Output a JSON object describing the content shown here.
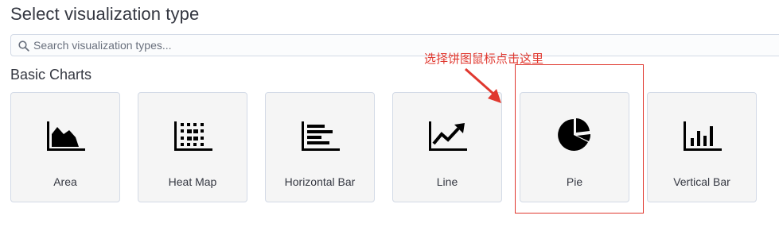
{
  "header": {
    "title": "Select visualization type"
  },
  "search": {
    "placeholder": "Search visualization types..."
  },
  "section": {
    "title": "Basic Charts"
  },
  "cards": [
    {
      "label": "Area",
      "icon": "area-chart-icon"
    },
    {
      "label": "Heat Map",
      "icon": "heat-map-icon"
    },
    {
      "label": "Horizontal Bar",
      "icon": "horizontal-bar-icon"
    },
    {
      "label": "Line",
      "icon": "line-chart-icon"
    },
    {
      "label": "Pie",
      "icon": "pie-chart-icon"
    },
    {
      "label": "Vertical Bar",
      "icon": "vertical-bar-icon"
    }
  ],
  "annotation": {
    "text": "选择饼图鼠标点击这里",
    "color": "#e0382f"
  },
  "colors": {
    "accent": "#e0382f",
    "card_bg": "#f5f5f5",
    "text": "#343741"
  }
}
